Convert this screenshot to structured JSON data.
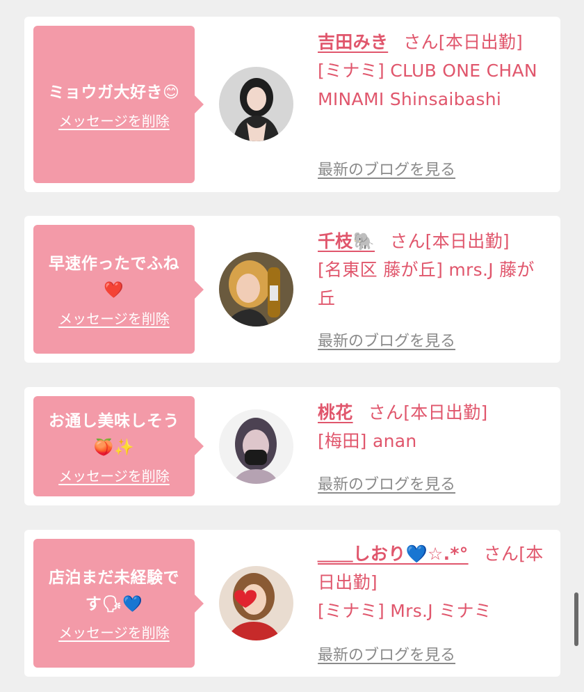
{
  "common": {
    "delete_label": "メッセージを削除",
    "blog_label": "最新のブログを見る"
  },
  "cards": [
    {
      "message": "ミョウガ大好き😊",
      "name": "吉田みき",
      "status": "さん[本日出勤]",
      "store": "[ミナミ] CLUB ONE CHAN MINAMI Shinsaibashi"
    },
    {
      "message": "早速作ったでふね❤️",
      "name": "千枝🐘",
      "status": "さん[本日出勤]",
      "store": "[名東区 藤が丘] mrs.J 藤が丘"
    },
    {
      "message": "お通し美味しそう🍑✨",
      "name": "桃花",
      "status": "さん[本日出勤]",
      "store": "[梅田] anan"
    },
    {
      "message": "店泊まだ未経験です🗣💙",
      "name": "＿＿しおり💙☆.*°",
      "status": "さん[本日出勤]",
      "store": "[ミナミ] Mrs.J ミナミ"
    }
  ],
  "colors": {
    "accent": "#e0566c",
    "bubble": "#f39aa8",
    "link_gray": "#8a8a8a",
    "background": "#efefef"
  }
}
